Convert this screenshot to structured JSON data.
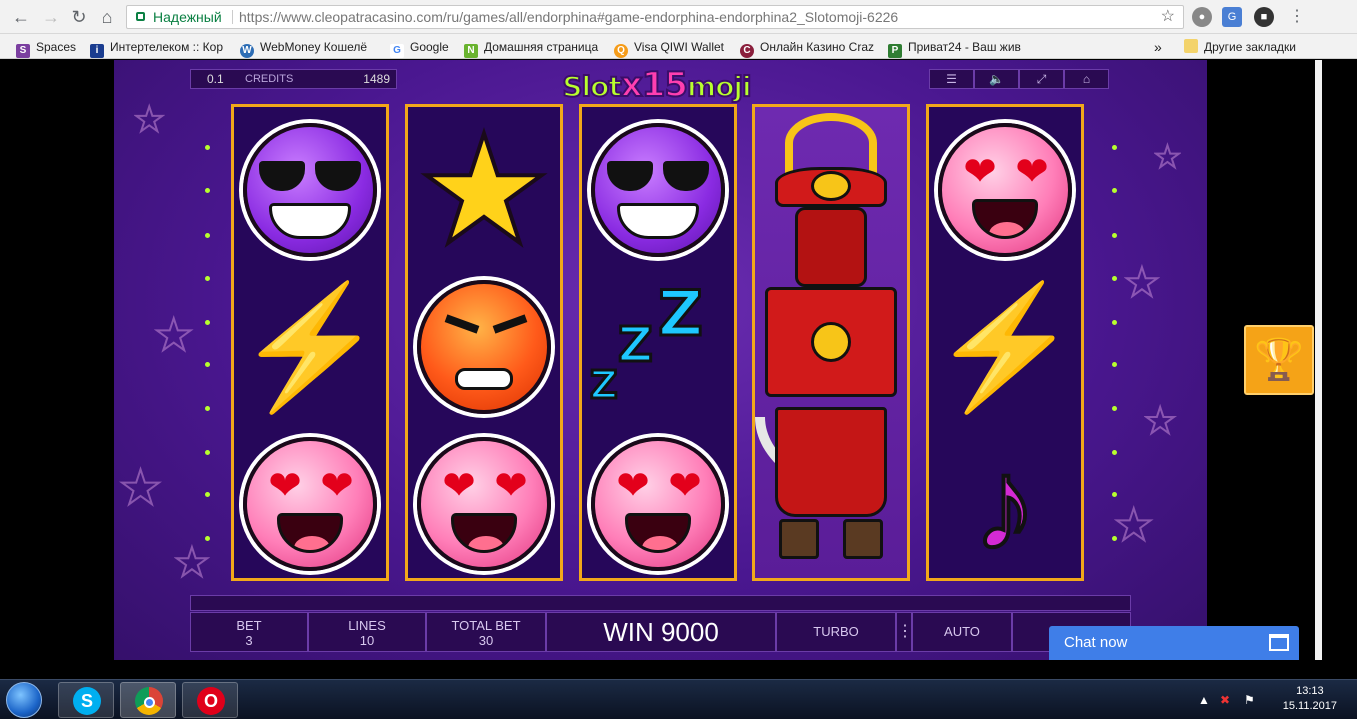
{
  "browser": {
    "secure_label": "Надежный",
    "url": "https://www.cleopatracasino.com/ru/games/all/endorphina#game-endorphina-endorphina2_Slotomoji-6226",
    "bookmarks": [
      {
        "label": "Spaces",
        "color": "#7b3fa0",
        "glyph": "S"
      },
      {
        "label": "Интертелеком :: Кор",
        "color": "#1a3c8f",
        "glyph": "i"
      },
      {
        "label": "WebMoney Кошелё",
        "color": "#2d6db5",
        "glyph": "W"
      },
      {
        "label": "Google",
        "color": "#4285f4",
        "glyph": "G"
      },
      {
        "label": "Домашняя страница",
        "color": "#69b32e",
        "glyph": "N"
      },
      {
        "label": "Visa QIWI Wallet",
        "color": "#f59c1a",
        "glyph": "Q"
      },
      {
        "label": "Онлайн Казино Craz",
        "color": "#8a1f3c",
        "glyph": "C"
      },
      {
        "label": "Приват24 - Ваш жив",
        "color": "#2f7d32",
        "glyph": "P"
      }
    ],
    "more_label": "»",
    "other_bookmarks": "Другие закладки"
  },
  "game": {
    "logo_left": "Slot",
    "logo_mid": "x15",
    "logo_right": "moji",
    "line_bet": "0.1",
    "credits_label": "CREDITS",
    "credits_value": "1489",
    "bet_label": "BET",
    "bet_value": "3",
    "lines_label": "LINES",
    "lines_value": "10",
    "total_bet_label": "TOTAL BET",
    "total_bet_value": "30",
    "win_text": "WIN 9000",
    "turbo_label": "TURBO",
    "auto_label": "AUTO"
  },
  "icons": {
    "menu": "menu-icon",
    "sound": "sound-icon",
    "fullscreen": "fullscreen-icon",
    "home": "home-icon"
  },
  "chat": {
    "label": "Chat now"
  },
  "taskbar": {
    "time": "13:13",
    "date": "15.11.2017"
  },
  "colors": {
    "reel_border": "#f2a81a",
    "game_bg": "#4a1790",
    "chat_blue": "#3f7ee8",
    "accent_green": "#b8ff2e"
  }
}
